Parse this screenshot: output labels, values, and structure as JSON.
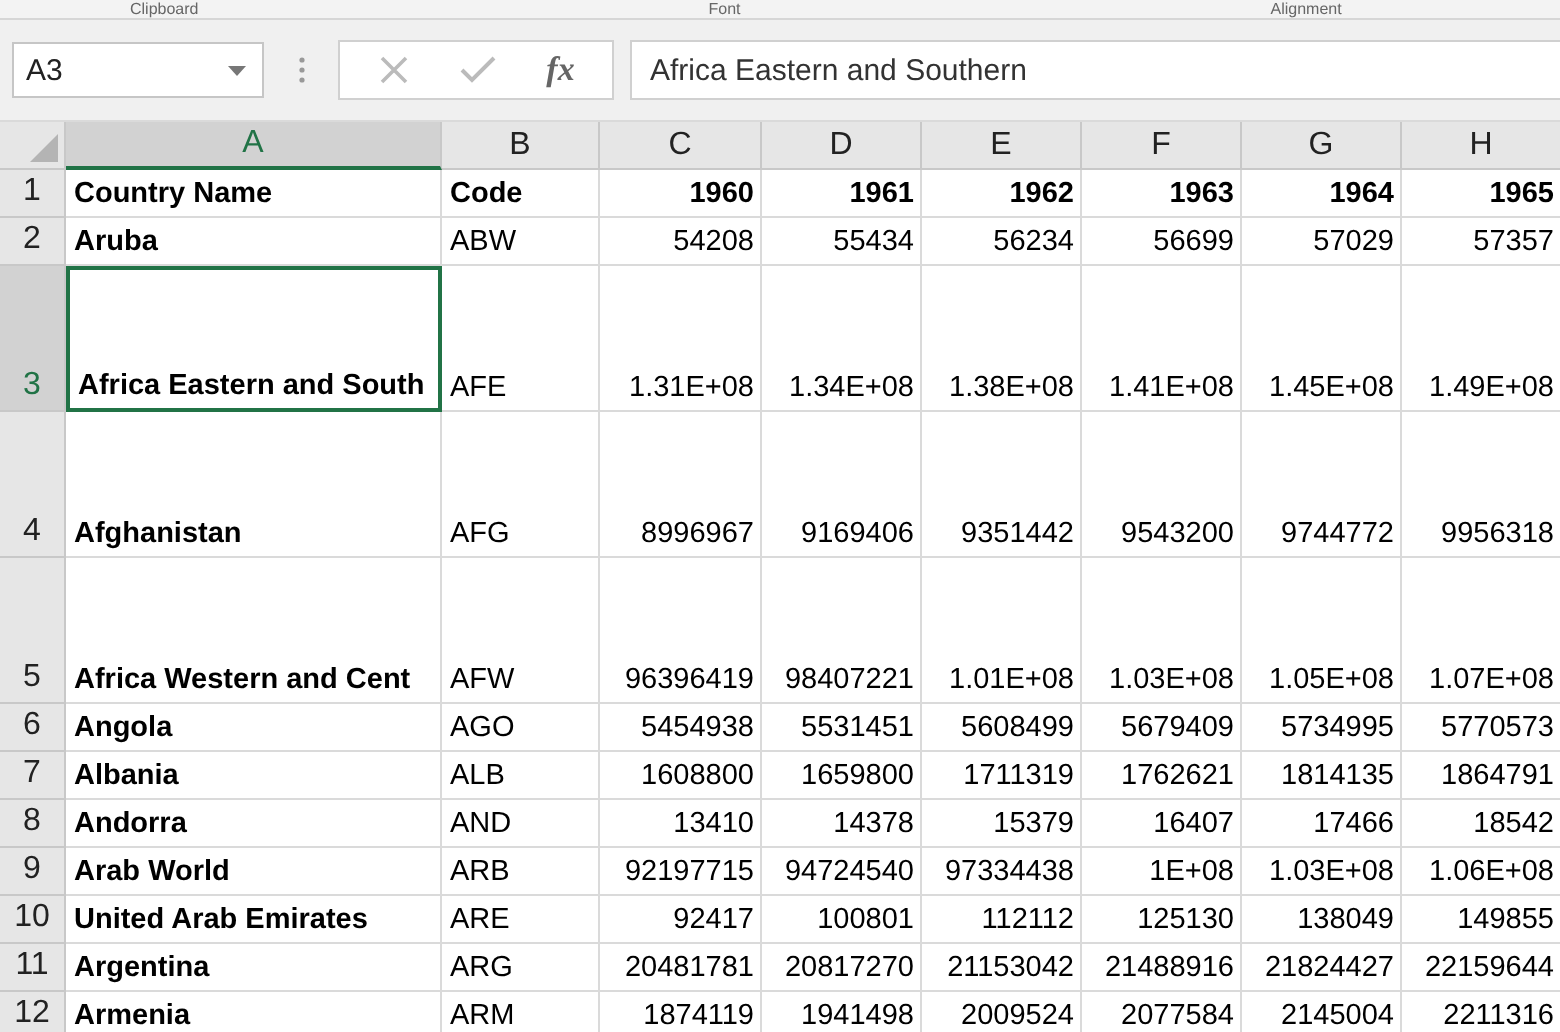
{
  "ribbon": {
    "group_labels": [
      "Clipboard",
      "Font",
      "Alignment"
    ]
  },
  "formula_bar": {
    "name_box": "A3",
    "function_label": "fx",
    "value": "Africa Eastern and Southern"
  },
  "columns": [
    {
      "label": "A",
      "selected": true
    },
    {
      "label": "B",
      "selected": false
    },
    {
      "label": "C",
      "selected": false
    },
    {
      "label": "D",
      "selected": false
    },
    {
      "label": "E",
      "selected": false
    },
    {
      "label": "F",
      "selected": false
    },
    {
      "label": "G",
      "selected": false
    },
    {
      "label": "H",
      "selected": false
    }
  ],
  "rows": [
    {
      "number": "1",
      "kind": "header",
      "tall": false,
      "selected": false,
      "cells": [
        "Country Name",
        "Code",
        "1960",
        "1961",
        "1962",
        "1963",
        "1964",
        "1965"
      ]
    },
    {
      "number": "2",
      "kind": "data",
      "tall": false,
      "selected": false,
      "cells": [
        "Aruba",
        "ABW",
        "54208",
        "55434",
        "56234",
        "56699",
        "57029",
        "57357"
      ]
    },
    {
      "number": "3",
      "kind": "data",
      "tall": true,
      "selected": true,
      "cells": [
        "Africa Eastern and South",
        "AFE",
        "1.31E+08",
        "1.34E+08",
        "1.38E+08",
        "1.41E+08",
        "1.45E+08",
        "1.49E+08"
      ]
    },
    {
      "number": "4",
      "kind": "data",
      "tall": true,
      "selected": false,
      "cells": [
        "Afghanistan",
        "AFG",
        "8996967",
        "9169406",
        "9351442",
        "9543200",
        "9744772",
        "9956318"
      ]
    },
    {
      "number": "5",
      "kind": "data",
      "tall": true,
      "selected": false,
      "cells": [
        "Africa Western and Cent",
        "AFW",
        "96396419",
        "98407221",
        "1.01E+08",
        "1.03E+08",
        "1.05E+08",
        "1.07E+08"
      ]
    },
    {
      "number": "6",
      "kind": "data",
      "tall": false,
      "selected": false,
      "cells": [
        "Angola",
        "AGO",
        "5454938",
        "5531451",
        "5608499",
        "5679409",
        "5734995",
        "5770573"
      ]
    },
    {
      "number": "7",
      "kind": "data",
      "tall": false,
      "selected": false,
      "cells": [
        "Albania",
        "ALB",
        "1608800",
        "1659800",
        "1711319",
        "1762621",
        "1814135",
        "1864791"
      ]
    },
    {
      "number": "8",
      "kind": "data",
      "tall": false,
      "selected": false,
      "cells": [
        "Andorra",
        "AND",
        "13410",
        "14378",
        "15379",
        "16407",
        "17466",
        "18542"
      ]
    },
    {
      "number": "9",
      "kind": "data",
      "tall": false,
      "selected": false,
      "cells": [
        "Arab World",
        "ARB",
        "92197715",
        "94724540",
        "97334438",
        "1E+08",
        "1.03E+08",
        "1.06E+08"
      ]
    },
    {
      "number": "10",
      "kind": "data",
      "tall": false,
      "selected": false,
      "cells": [
        "United Arab Emirates",
        "ARE",
        "92417",
        "100801",
        "112112",
        "125130",
        "138049",
        "149855"
      ]
    },
    {
      "number": "11",
      "kind": "data",
      "tall": false,
      "selected": false,
      "cells": [
        "Argentina",
        "ARG",
        "20481781",
        "20817270",
        "21153042",
        "21488916",
        "21824427",
        "22159644"
      ]
    },
    {
      "number": "12",
      "kind": "data",
      "tall": false,
      "selected": false,
      "cells": [
        "Armenia",
        "ARM",
        "1874119",
        "1941498",
        "2009524",
        "2077584",
        "2145004",
        "2211316"
      ]
    }
  ]
}
